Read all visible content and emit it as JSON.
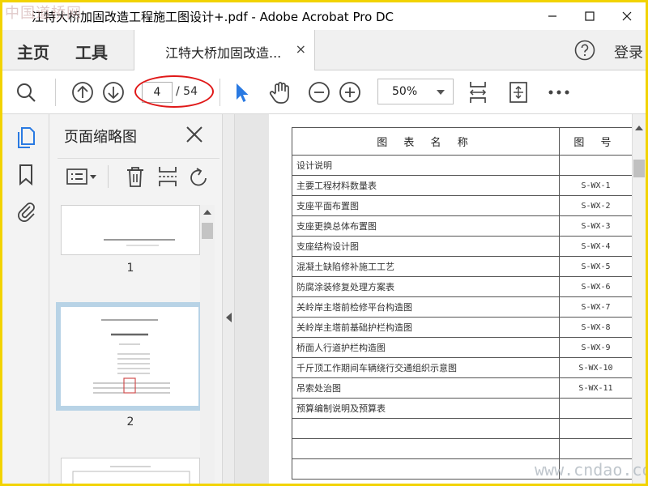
{
  "window": {
    "title": "江特大桥加固改造工程施工图设计+.pdf - Adobe Acrobat Pro DC",
    "minimize_icon": "minimize-icon",
    "maximize_icon": "maximize-icon",
    "close_icon": "close-icon"
  },
  "watermarks": {
    "top_left": "中国道桥网",
    "bottom_right": "www.cndao.com"
  },
  "menu": {
    "home": "主页",
    "tools": "工具",
    "doc_tab": "江特大桥加固改造...",
    "doc_tab_close": "×",
    "login": "登录"
  },
  "toolbar": {
    "current_page": "4",
    "page_total": "/ 54",
    "zoom": "50%",
    "accent_color": "#2a7ae2",
    "highlight_color": "#e01818"
  },
  "panel": {
    "title": "页面缩略图",
    "thumbnails": [
      {
        "number": "1"
      },
      {
        "number": "2",
        "selected": true
      }
    ]
  },
  "document": {
    "header": {
      "name": "图 表 名 称",
      "code": "图 号"
    },
    "rows": [
      {
        "name": "设计说明",
        "code": ""
      },
      {
        "name": "主要工程材料数量表",
        "code": "S-WX-1"
      },
      {
        "name": "支座平面布置图",
        "code": "S-WX-2"
      },
      {
        "name": "支座更换总体布置图",
        "code": "S-WX-3"
      },
      {
        "name": "支座结构设计图",
        "code": "S-WX-4"
      },
      {
        "name": "混凝土缺陷修补施工工艺",
        "code": "S-WX-5"
      },
      {
        "name": "防腐涂装修复处理方案表",
        "code": "S-WX-6"
      },
      {
        "name": "关岭岸主塔前检修平台构造图",
        "code": "S-WX-7"
      },
      {
        "name": "关岭岸主塔前基础护栏构造图",
        "code": "S-WX-8"
      },
      {
        "name": "桥面人行道护栏构造图",
        "code": "S-WX-9"
      },
      {
        "name": "千斤顶工作期间车辆绕行交通组织示意图",
        "code": "S-WX-10"
      },
      {
        "name": "吊索处治图",
        "code": "S-WX-11"
      },
      {
        "name": "预算编制说明及预算表",
        "code": ""
      },
      {
        "name": "",
        "code": ""
      },
      {
        "name": "",
        "code": ""
      },
      {
        "name": "",
        "code": ""
      }
    ]
  }
}
